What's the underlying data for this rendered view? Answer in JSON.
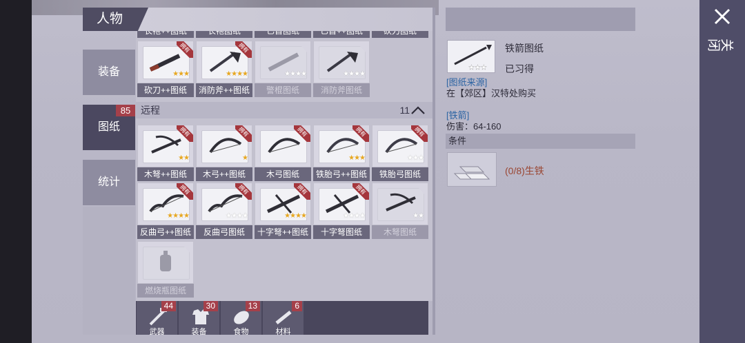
{
  "panel": {
    "title": "人物"
  },
  "categories": [
    {
      "label": "装备"
    },
    {
      "label": "图纸",
      "badge": "85"
    },
    {
      "label": "统计"
    }
  ],
  "top_row": [
    "长袍++图纸",
    "长袍图纸",
    "匕首图纸",
    "匕首++图纸",
    "砍刀图纸"
  ],
  "melee_row": [
    {
      "label": "砍刀++图纸",
      "stars": 3,
      "max": 3,
      "owned": true,
      "dim": false,
      "icon": "machete-icon"
    },
    {
      "label": "消防斧++图纸",
      "stars": 4,
      "max": 4,
      "owned": true,
      "dim": false,
      "icon": "fire-axe-icon"
    },
    {
      "label": "警棍图纸",
      "stars": 0,
      "max": 4,
      "owned": false,
      "dim": true,
      "icon": "baton-icon"
    },
    {
      "label": "消防斧图纸",
      "stars": 0,
      "max": 4,
      "owned": false,
      "dim": true,
      "icon": "fire-axe-icon"
    }
  ],
  "ranged_section": {
    "label": "远程",
    "count": "11"
  },
  "ranged_row1": [
    {
      "label": "木弩++图纸",
      "stars": 2,
      "max": 2,
      "owned": true,
      "dim": false,
      "icon": "wood-crossbow-icon"
    },
    {
      "label": "木弓++图纸",
      "stars": 1,
      "max": 1,
      "owned": true,
      "dim": false,
      "icon": "wood-bow-icon"
    },
    {
      "label": "木弓图纸",
      "stars": 0,
      "max": 0,
      "owned": true,
      "dim": false,
      "icon": "wood-bow-icon"
    },
    {
      "label": "铁胎弓++图纸",
      "stars": 3,
      "max": 3,
      "owned": true,
      "dim": false,
      "icon": "iron-bow-icon"
    },
    {
      "label": "铁胎弓图纸",
      "stars": 0,
      "max": 3,
      "owned": true,
      "dim": false,
      "icon": "iron-bow-icon"
    }
  ],
  "ranged_row2": [
    {
      "label": "反曲弓++图纸",
      "stars": 4,
      "max": 4,
      "owned": true,
      "dim": false,
      "icon": "recurve-bow-icon"
    },
    {
      "label": "反曲弓图纸",
      "stars": 0,
      "max": 4,
      "owned": true,
      "dim": false,
      "icon": "recurve-bow-icon"
    },
    {
      "label": "十字弩++图纸",
      "stars": 4,
      "max": 4,
      "owned": true,
      "dim": false,
      "icon": "cross-crossbow-icon"
    },
    {
      "label": "十字弩图纸",
      "stars": 0,
      "max": 4,
      "owned": true,
      "dim": false,
      "icon": "cross-crossbow-icon"
    },
    {
      "label": "木弩图纸",
      "stars": 0,
      "max": 2,
      "owned": false,
      "dim": true,
      "icon": "wood-crossbow-icon"
    }
  ],
  "ranged_row3": [
    {
      "label": "燃烧瓶图纸",
      "stars": 0,
      "max": 0,
      "owned": false,
      "dim": true,
      "icon": "molotov-icon"
    }
  ],
  "inventory": [
    {
      "label": "武器",
      "count": "44",
      "icon": "weapon-icon"
    },
    {
      "label": "装备",
      "count": "30",
      "icon": "shirt-icon"
    },
    {
      "label": "食物",
      "count": "13",
      "icon": "food-icon"
    },
    {
      "label": "材料",
      "count": "6",
      "icon": "material-icon"
    }
  ],
  "detail": {
    "name": "铁箭图纸",
    "status": "已习得",
    "source_title": "[图纸来源]",
    "source_text": "在【郊区】汉特处购买",
    "item_title": "[铁箭]",
    "damage": "伤害：64-160",
    "stars": 3,
    "condition_title": "条件",
    "material_text": "(0/8)生铁"
  },
  "close": {
    "label": "关闭"
  }
}
